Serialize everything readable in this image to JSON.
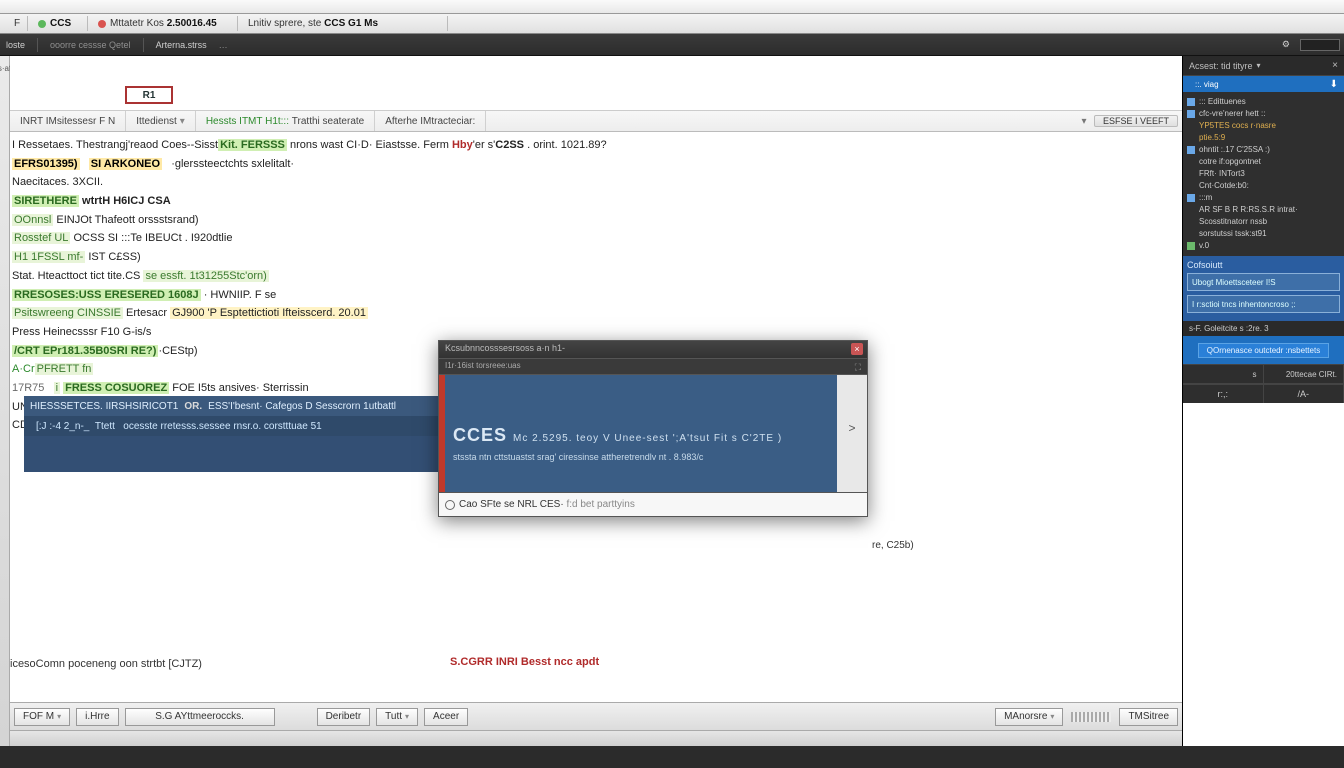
{
  "tabs": [
    {
      "icon_color": "#d9534f",
      "label_a": "F",
      "label_b": ""
    },
    {
      "icon_color": "#5cb85c",
      "label_a": "CCS",
      "label_b": ""
    },
    {
      "icon_color": "#d9534f",
      "label_a": "Mttatetr Kos",
      "label_b": "2.50016.45"
    },
    {
      "icon_color": null,
      "label_a": "Lnitiv sprere, ste",
      "label_b": "CCS G1 Ms"
    }
  ],
  "toolbar": {
    "a": "loste",
    "b": "ooorre cessse Qetel",
    "c": "Arterna.strss",
    "dots": "…"
  },
  "page_tab_label": "R1",
  "subtabs": {
    "items": [
      "INRT IMsitessesr F N",
      "Ittedienst",
      "Hessts ITMT H1t:::",
      "Tratthi seaterate",
      "Afterhe IMtracteciar:"
    ],
    "right_button": "ESFSE I VEEFT"
  },
  "doc": {
    "l1_a": "I Ressetaes. Thestrangj'reaod Coes--Sisst",
    "l1_b": "Kit. FERSSS",
    "l1_c": "nrons wast CI·D· Eiastsse. Ferm",
    "l1_hby": "Hby",
    "l1_d": "'er s'",
    "l1_css": "C2SS",
    "l1_e": ". orint. 1021.89?",
    "l2_a": "EFRS01395)",
    "l2_b": "SI ARKONEO",
    "l2_c": "·glerssteectchts sxlelitalt·",
    "l3": "Naecitaces. 3XCII.",
    "l4_a": "SIRETHERE",
    "l4_b": "wtrtH H6ICJ CSA",
    "l5_a": "OOnnsl",
    "l5_b": "EINJOt Thafeott orssstsrand)",
    "l6_a": "Rosstef UL",
    "l6_b": "OCSS SI :::Te IBEUCt . I920dtlie",
    "l7_a": "H1 1FSSL mf-",
    "l7_b": "IST C£SS)",
    "l8_a": "Stat. Hteacttoct tict tite.CS",
    "l8_b": "se essft. 1t31255Stc'orn)",
    "l9_a": "RRESOSES:USS ERESERED 1608J",
    "l9_b": "· HWNIIP. F se",
    "l10_a": "Psitswreeng CINSSIE",
    "l10_b": "Ertesacr",
    "l10_c": "GJ900 'P Esptettictioti Ifteisscerd. 20.01",
    "l11": "Press Heinecsssr F10 G-is/s",
    "l12_a": "/CRT EPr181.35B0SRI RE?)",
    "l12_b": "·CEStp)",
    "l13_a": "A·Cr",
    "l13_b": "PFRETT fn",
    "l14_a": "17R75",
    "l14_b": "i",
    "l14_c": "FRESS COSUOREZ",
    "l14_d": "FOE I5ts ansives· Sterrissin",
    "l15": "UN Gll3SS)",
    "l16": "CDIE Bsesat.",
    "sel_left": "HIESSSETCES. IIRSHSIRICOT1",
    "sel_or": "OR.",
    "sel_mid": "ESS'I'besnt· Cafegos",
    "sel_right": "D Sesscrorn 1utbattl",
    "sel_dangle": "re, C25b)",
    "sel2_a": "[:J :-4 2_n-_",
    "sel2_b": "Ttett",
    "sel2_c": "ocesste rretesss.sessee rnsr.o. corstttuae 51",
    "footer": "icesoComn poceneng oon strtbt [CJTZ)",
    "err": "S.CGRR INRI Besst ncc apdt"
  },
  "dialog": {
    "title": "Kcsubnncosssesrsoss a·n h1-",
    "ribbon": "I1r·16ist torsreee:uas",
    "max_icon": "⛶",
    "t1": "CCES",
    "t1_sub": "Mc 2.5295. teoy V Unee-sest ';A'tsut Fit s C'2TE )",
    "t2": "stssta ntn cttstuastst srag' ciressinse attheretrendlv nt . 8.983/c",
    "arrow": ">",
    "input_label": "Cao SFte se NRL CES·",
    "input_tail": "f:d bet parttyins",
    "close": "×"
  },
  "bottom": {
    "b1": "FOF M",
    "b2": "i.Hrre",
    "b3": "S.G AYttmeeroccks.",
    "b4": "Deribetr",
    "b5": "Tutt",
    "b6": "Aceer",
    "b7": "MAnorsre",
    "b8": "TMSitree"
  },
  "right": {
    "header": "Acsest: tid tityre",
    "tabs": {
      "a": "::. viag",
      "b": ""
    },
    "tree": [
      "::: Edittuenes",
      "cfc-vre'nerer hett ::",
      "YP5TES  cocs r·nasre",
      "ptie.5:9",
      "ohntit  :.17 C'25SA :)",
      "cotre  if:opgontnet",
      "FRft·  INTort3",
      "Cnt·Cotde:b0:",
      ":::m",
      "AR SF B R R:RS.S.R intrat·",
      "Scosstitnatorr nssb",
      "sorstutssi tssk:st91",
      "v.0"
    ],
    "cobalt": "Cofsoiutt",
    "field1": "Ubogt Mioettsceteer I!S",
    "field2": "I r:sctioi tncs inhentoncroso ;:",
    "small": "s-F.   Goleitcite s :2re. 3",
    "pill": "QOrnenasce outctedr :nsbettets",
    "cell_a": "s",
    "cell_b": "20ttecae CIRt.",
    "seg_a": "r:,:",
    "seg_b": "/A-"
  },
  "tb_right": {
    "a": "",
    "gear": "⚙"
  }
}
